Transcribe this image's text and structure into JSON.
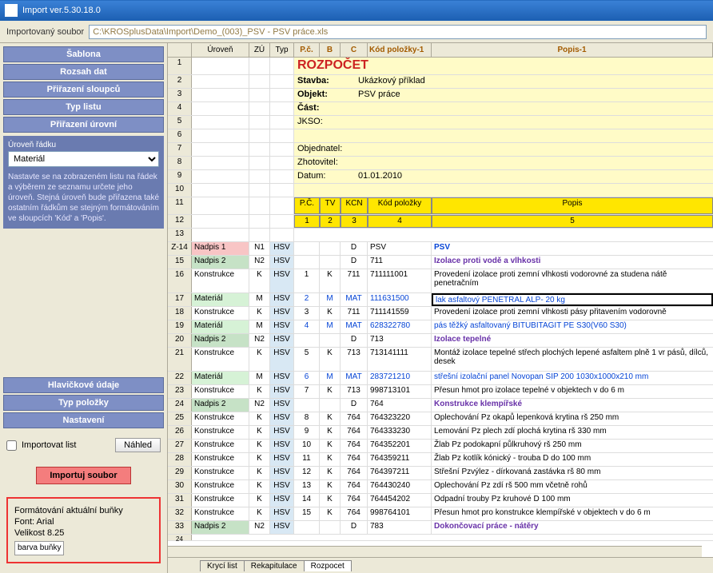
{
  "title": "Import ver.5.30.18.0",
  "toolbar": {
    "label": "Importovaný soubor",
    "path": "C:\\KROSplusData\\Import\\Demo_(003)_PSV - PSV práce.xls"
  },
  "sidebar": {
    "top": [
      "Šablona",
      "Rozsah dat",
      "Přiřazení sloupců",
      "Typ listu",
      "Přiřazení úrovní"
    ],
    "levelLabel": "Úroveň řádku",
    "levelValue": "Materiál",
    "hint": "Nastavte se na zobrazeném listu na řádek a výběrem ze seznamu určete jeho úroveň. Stejná úroveň bude přiřazena také ostatním řádkům se stejným formátováním ve sloupcích 'Kód' a 'Popis'.",
    "bottom": [
      "Hlavičkové údaje",
      "Typ položky",
      "Nastavení"
    ],
    "chkImport": "Importovat list",
    "btnPreview": "Náhled",
    "btnImport": "Importuj soubor",
    "infoTitle": "Formátování aktuální buňky",
    "infoFont": "Font: Arial",
    "infoSize": "Velikost 8.25",
    "infoColor": "barva buňky"
  },
  "cols": {
    "uroven": "Úroveň",
    "zu": "ZÚ",
    "typ": "Typ",
    "pc": "P.č.",
    "b": "B",
    "c": "C",
    "kod": "Kód položky-1",
    "popis": "Popis-1"
  },
  "header": {
    "title": "ROZPOČET",
    "stavba_l": "Stavba:",
    "stavba_v": "Ukázkový příklad",
    "objekt_l": "Objekt:",
    "objekt_v": "PSV práce",
    "cast_l": "Část:",
    "jkso_l": "JKSO:",
    "obj_l": "Objednatel:",
    "zho_l": "Zhotovitel:",
    "datum_l": "Datum:",
    "datum_v": "01.01.2010"
  },
  "band": {
    "pc": "P.Č.",
    "tv": "TV",
    "kcn": "KCN",
    "kod": "Kód položky",
    "popis": "Popis",
    "n1": "1",
    "n2": "2",
    "n3": "3",
    "n4": "4",
    "n5": "5"
  },
  "rows": [
    {
      "n": "Z-14",
      "rc": "#f8c5c5",
      "lvl": "Nadpis 1",
      "zu": "N1",
      "typ": "HSV",
      "pc": "",
      "b": "",
      "c": "D",
      "kod": "PSV",
      "pop": "PSV",
      "cls": "bold blue"
    },
    {
      "n": "15",
      "rc": "#c6e2c6",
      "lvl": "Nadpis 2",
      "zu": "N2",
      "typ": "HSV",
      "pc": "",
      "b": "",
      "c": "D",
      "kod": "711",
      "pop": "Izolace proti vodě a vlhkosti",
      "cls": "bold purple"
    },
    {
      "n": "16",
      "rc": "",
      "lvl": "Konstrukce",
      "zu": "K",
      "typ": "HSV",
      "pc": "1",
      "b": "K",
      "c": "711",
      "kod": "711111001",
      "pop": "Provedení izolace proti zemní vlhkosti vodorovné za studena nátě penetračním",
      "cls": ""
    },
    {
      "n": "17",
      "rc": "#d6f2d6",
      "lvl": "Materiál",
      "zu": "M",
      "typ": "HSV",
      "pc": "2",
      "tc": "#0645d6",
      "b": "M",
      "c": "MAT",
      "kod": "111631500",
      "pop": "lak asfaltový PENETRAL ALP- 20 kg",
      "cls": "blue sel"
    },
    {
      "n": "18",
      "rc": "",
      "lvl": "Konstrukce",
      "zu": "K",
      "typ": "HSV",
      "pc": "3",
      "b": "K",
      "c": "711",
      "kod": "711141559",
      "pop": "Provedení izolace proti zemní vlhkosti pásy přitavením vodorovně",
      "cls": ""
    },
    {
      "n": "19",
      "rc": "#d6f2d6",
      "lvl": "Materiál",
      "zu": "M",
      "typ": "HSV",
      "pc": "4",
      "tc": "#0645d6",
      "b": "M",
      "c": "MAT",
      "kod": "628322780",
      "pop": "pás těžký asfaltovaný BITUBITAGIT PE S30(V60 S30)",
      "cls": "blue"
    },
    {
      "n": "20",
      "rc": "#c6e2c6",
      "lvl": "Nadpis 2",
      "zu": "N2",
      "typ": "HSV",
      "pc": "",
      "b": "",
      "c": "D",
      "kod": "713",
      "pop": "Izolace tepelné",
      "cls": "bold purple"
    },
    {
      "n": "21",
      "rc": "",
      "lvl": "Konstrukce",
      "zu": "K",
      "typ": "HSV",
      "pc": "5",
      "b": "K",
      "c": "713",
      "kod": "713141111",
      "pop": "Montáž izolace tepelné střech plochých lepené asfaltem plně 1 vr pásů, dílců, desek",
      "cls": ""
    },
    {
      "n": "22",
      "rc": "#d6f2d6",
      "lvl": "Materiál",
      "zu": "M",
      "typ": "HSV",
      "pc": "6",
      "tc": "#0645d6",
      "b": "M",
      "c": "MAT",
      "kod": "283721210",
      "pop": "střešní izolační panel Novopan SIP 200 1030x1000x210 mm",
      "cls": "blue"
    },
    {
      "n": "23",
      "rc": "",
      "lvl": "Konstrukce",
      "zu": "K",
      "typ": "HSV",
      "pc": "7",
      "b": "K",
      "c": "713",
      "kod": "998713101",
      "pop": "Přesun hmot pro izolace tepelné v objektech v do 6 m",
      "cls": ""
    },
    {
      "n": "24",
      "rc": "#c6e2c6",
      "lvl": "Nadpis 2",
      "zu": "N2",
      "typ": "HSV",
      "pc": "",
      "b": "",
      "c": "D",
      "kod": "764",
      "pop": "Konstrukce klempířské",
      "cls": "bold purple"
    },
    {
      "n": "25",
      "rc": "",
      "lvl": "Konstrukce",
      "zu": "K",
      "typ": "HSV",
      "pc": "8",
      "b": "K",
      "c": "764",
      "kod": "764323220",
      "pop": "Oplechování Pz okapů lepenková krytina rš 250 mm",
      "cls": ""
    },
    {
      "n": "26",
      "rc": "",
      "lvl": "Konstrukce",
      "zu": "K",
      "typ": "HSV",
      "pc": "9",
      "b": "K",
      "c": "764",
      "kod": "764333230",
      "pop": "Lemování Pz plech zdí plochá krytina rš 330 mm",
      "cls": ""
    },
    {
      "n": "27",
      "rc": "",
      "lvl": "Konstrukce",
      "zu": "K",
      "typ": "HSV",
      "pc": "10",
      "b": "K",
      "c": "764",
      "kod": "764352201",
      "pop": "Žlab Pz podokapní půlkruhový rš 250 mm",
      "cls": ""
    },
    {
      "n": "28",
      "rc": "",
      "lvl": "Konstrukce",
      "zu": "K",
      "typ": "HSV",
      "pc": "11",
      "b": "K",
      "c": "764",
      "kod": "764359211",
      "pop": "Žlab Pz kotlík kónický - trouba D do 100 mm",
      "cls": ""
    },
    {
      "n": "29",
      "rc": "",
      "lvl": "Konstrukce",
      "zu": "K",
      "typ": "HSV",
      "pc": "12",
      "b": "K",
      "c": "764",
      "kod": "764397211",
      "pop": "Střešní Pzvýlez - dírkovaná zastávka rš 80 mm",
      "cls": ""
    },
    {
      "n": "30",
      "rc": "",
      "lvl": "Konstrukce",
      "zu": "K",
      "typ": "HSV",
      "pc": "13",
      "b": "K",
      "c": "764",
      "kod": "764430240",
      "pop": "Oplechování Pz zdí rš 500 mm včetně rohů",
      "cls": ""
    },
    {
      "n": "31",
      "rc": "",
      "lvl": "Konstrukce",
      "zu": "K",
      "typ": "HSV",
      "pc": "14",
      "b": "K",
      "c": "764",
      "kod": "764454202",
      "pop": "Odpadní trouby Pz kruhové D 100 mm",
      "cls": ""
    },
    {
      "n": "32",
      "rc": "",
      "lvl": "Konstrukce",
      "zu": "K",
      "typ": "HSV",
      "pc": "15",
      "b": "K",
      "c": "764",
      "kod": "998764101",
      "pop": "Přesun hmot pro konstrukce klempířské v objektech v do 6 m",
      "cls": ""
    },
    {
      "n": "33",
      "rc": "#c6e2c6",
      "lvl": "Nadpis 2",
      "zu": "N2",
      "typ": "HSV",
      "pc": "",
      "b": "",
      "c": "D",
      "kod": "783",
      "pop": "Dokončovací práce - nátěry",
      "cls": "bold purple"
    }
  ],
  "tabs": [
    "Krycí list",
    "Rekapitulace",
    "Rozpocet"
  ]
}
